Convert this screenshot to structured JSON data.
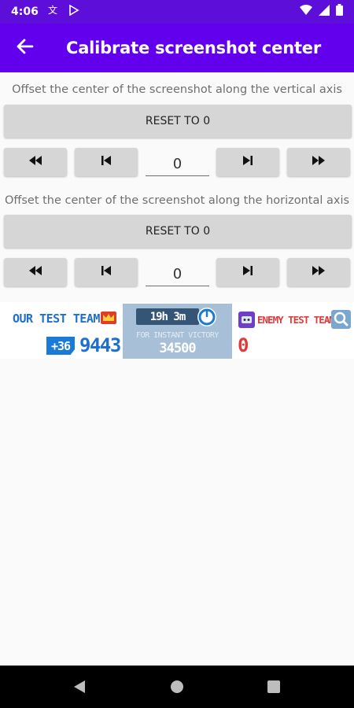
{
  "status_bar": {
    "time": "4:06",
    "left_icons": [
      "translate-icon",
      "play-store-icon"
    ],
    "right_icons": [
      "wifi-icon",
      "signal-icon",
      "battery-icon"
    ]
  },
  "app_bar": {
    "back_icon": "arrow-back-icon",
    "title": "Calibrate screenshot center"
  },
  "vertical": {
    "caption": "Offset the center of the screenshot along the vertical axis",
    "reset_label": "RESET TO 0",
    "value": "0",
    "controls": [
      "fast-rewind-icon",
      "skip-previous-icon",
      "skip-next-icon",
      "fast-forward-icon"
    ]
  },
  "horizontal": {
    "caption": "Offset the center of the screenshot along the horizontal axis",
    "reset_label": "RESET TO 0",
    "value": "0",
    "controls": [
      "fast-rewind-icon",
      "skip-previous-icon",
      "skip-next-icon",
      "fast-forward-icon"
    ]
  },
  "game_preview": {
    "our_team": "OUR TEST TEAM",
    "bonus": "+36",
    "our_score": "9443",
    "timer": "19h 3m",
    "victory_label": "FOR INSTANT VICTORY",
    "victory_value": "34500",
    "enemy_team": "ENEMY TEST TEAM",
    "enemy_score": "0",
    "colors": {
      "our": "#1e6fd1",
      "enemy": "#e03a3a",
      "panel": "#a7bfd7"
    }
  },
  "nav_bar": {
    "icons": [
      "back-triangle-icon",
      "home-circle-icon",
      "recents-square-icon"
    ]
  },
  "colors": {
    "accent": "#6200ee",
    "status": "#5d0fd9",
    "button": "#d6d6d6"
  }
}
